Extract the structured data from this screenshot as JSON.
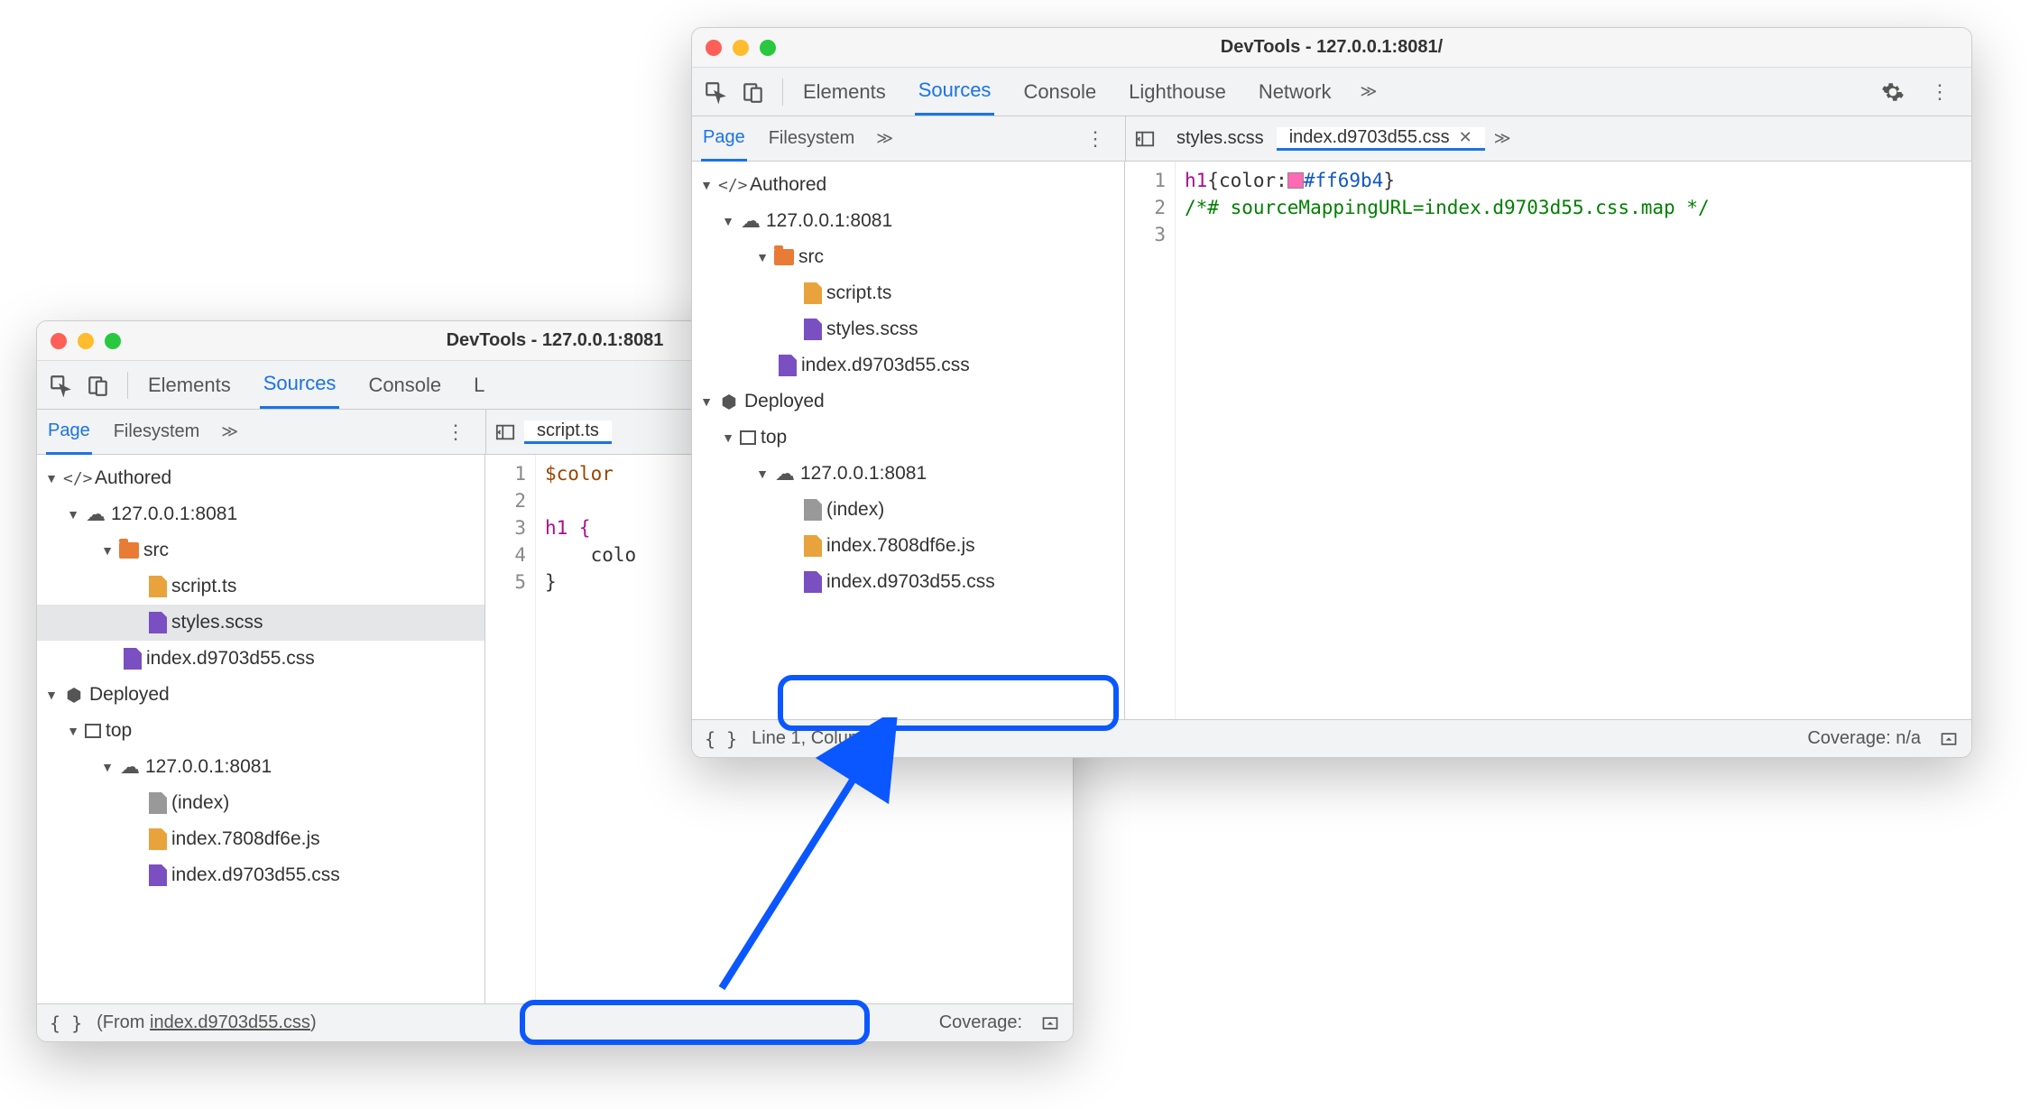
{
  "window1": {
    "title": "DevTools - 127.0.0.1:8081",
    "tabs": [
      "Elements",
      "Sources",
      "Console",
      "L"
    ],
    "activeTab": "Sources",
    "subTabs": [
      "Page",
      "Filesystem"
    ],
    "activeSubTab": "Page",
    "openFile": "script.ts",
    "tree": {
      "authored": "Authored",
      "host": "127.0.0.1:8081",
      "src": "src",
      "files": {
        "scriptts": "script.ts",
        "stylesscss": "styles.scss",
        "indexcss": "index.d9703d55.css"
      },
      "deployed": "Deployed",
      "top": "top",
      "deployedFiles": {
        "index": "(index)",
        "indexjs": "index.7808df6e.js",
        "indexcss2": "index.d9703d55.css"
      }
    },
    "code": {
      "line1": "$color",
      "line3": "h1 {",
      "line4": "    colo",
      "line5": "}"
    },
    "status": {
      "from_prefix": "(From ",
      "from_file": "index.d9703d55.css",
      "from_suffix": ")",
      "coverage": "Coverage:"
    }
  },
  "window2": {
    "title": "DevTools - 127.0.0.1:8081/",
    "tabs": [
      "Elements",
      "Sources",
      "Console",
      "Lighthouse",
      "Network"
    ],
    "activeTab": "Sources",
    "subTabs": [
      "Page",
      "Filesystem"
    ],
    "activeSubTab": "Page",
    "openFiles": [
      "styles.scss",
      "index.d9703d55.css"
    ],
    "activeOpenFile": "index.d9703d55.css",
    "tree": {
      "authored": "Authored",
      "host": "127.0.0.1:8081",
      "src": "src",
      "files": {
        "scriptts": "script.ts",
        "stylesscss": "styles.scss",
        "indexcss": "index.d9703d55.css"
      },
      "deployed": "Deployed",
      "top": "top",
      "deployedFiles": {
        "index": "(index)",
        "indexjs": "index.7808df6e.js",
        "indexcss2": "index.d9703d55.css"
      }
    },
    "code": {
      "sel": "h1",
      "brace_open": "{",
      "prop": "color:",
      "hex": "#ff69b4",
      "brace_close": "}",
      "comment": "/*# sourceMappingURL=index.d9703d55.css.map */"
    },
    "status": {
      "pos": "Line 1, Column 1",
      "coverage": "Coverage: n/a"
    }
  }
}
